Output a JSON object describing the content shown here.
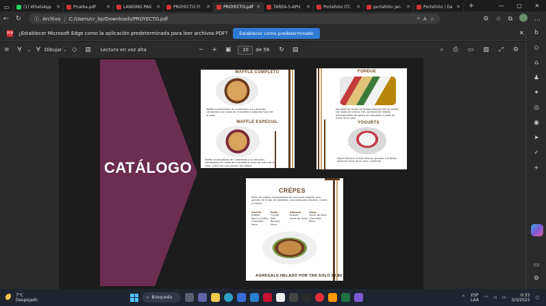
{
  "tabs": [
    {
      "label": "(1) WhatsApp",
      "color": "#25d366"
    },
    {
      "label": "Prueba.pdf",
      "color": "#d13438"
    },
    {
      "label": "LANDING PAG",
      "color": "#d13438"
    },
    {
      "label": "PROYECTO FI",
      "color": "#d13438"
    },
    {
      "label": "PROYECTO.pdf",
      "color": "#d13438",
      "active": true
    },
    {
      "label": "TAREA-5-APU",
      "color": "#d13438"
    },
    {
      "label": "Portafolio ITC",
      "color": "#d13438"
    },
    {
      "label": "portafolio jan",
      "color": "#d13438"
    },
    {
      "label": "Portafolio | Da",
      "color": "#d13438"
    }
  ],
  "address": {
    "site_label": "Archivo",
    "url": "C:/Users/cr_bp/Downloads/PROYECTO.pdf"
  },
  "infobar": {
    "message": "¿Establecer Microsoft Edge como la aplicación predeterminada para leer archivos PDF?",
    "button": "Establecer como predeterminado"
  },
  "pdf_toolbar": {
    "draw_label": "Dibujar",
    "read_aloud": "Lectura en voz alta",
    "page_current": "10",
    "page_total": "de 56"
  },
  "pdf": {
    "catalog_title": "CATÁLOGO",
    "accent_color": "#6b2d50",
    "cards": {
      "waffle_title": "WAFFLE COMPLETO",
      "waffle_desc": "Waffle acompañado de 3 adereses o su elección, combinado con salsa de chocolate o salsa de mora de la casa",
      "waffle2_title": "WAFFLE ESPECIAL",
      "waffle2_desc": "Waffle acompañado de 3 adereses o su elección, combinado con salsa de chocolate o salsa de mora de la casa, junto con una porción de helado",
      "fondue_title": "FONDUE",
      "fondue_desc": "Variedad de frutas de temporada,porción de queso, con salsa de crema, tres variedad de helado, acompañadas de salsas de chocolate o salsa de mora de la casa",
      "yogurt_title": "YOGURTS",
      "yogurt_desc": "Yogurt Natural, frutas frescas, granola o frutillas, salsa de mora de la casa, o granola.",
      "crepes_title": "CRÉPES",
      "crepes_desc": "Masa de crêpes, acompañado de una salsa estable, una porción de 6 tipo de adereses, una salsa para decorar, crema o frutilla",
      "crepes_cols": [
        {
          "head": "Sincilla",
          "items": [
            "Nutella",
            "Mora y frutilla",
            "Chocolate",
            "Mora"
          ]
        },
        {
          "head": "Fruta",
          "items": [
            "Frutilla",
            "Kiwi",
            "Banano",
            "Mora"
          ]
        },
        {
          "head": "Aderezo",
          "items": [
            "Nutella",
            "Dulce de leche"
          ]
        },
        {
          "head": "Salsa",
          "items": [
            "Leche de Mora",
            "Chocolate",
            "Mora"
          ]
        }
      ],
      "crepes_footer": "AGREGALE HELADO POR TAN SOLO $0.80"
    }
  },
  "taskbar": {
    "temp": "7°C",
    "weather": "Despejado",
    "search": "Búsqueda",
    "lang_top": "ESP",
    "lang_bottom": "LAA",
    "time": "0:33",
    "date": "3/3/2023"
  }
}
